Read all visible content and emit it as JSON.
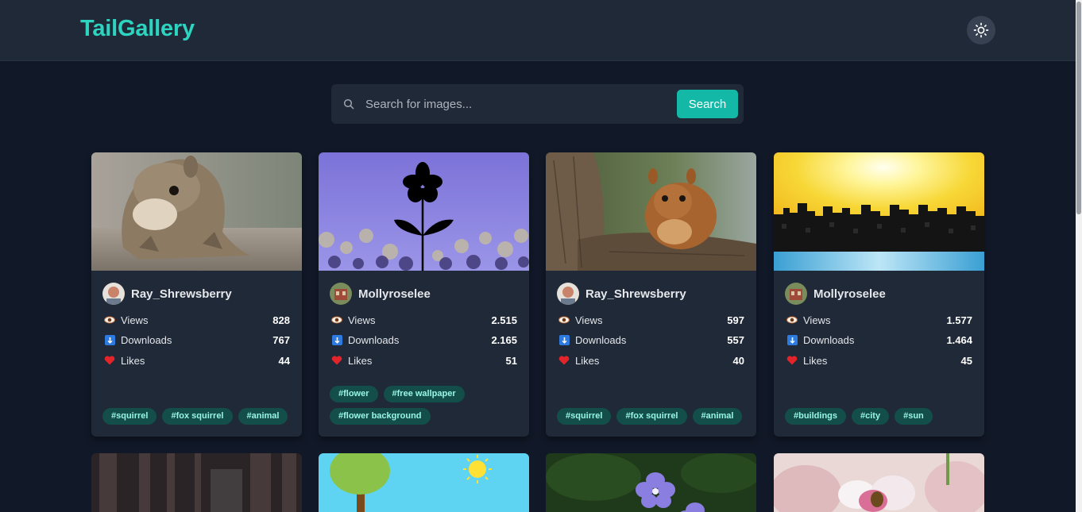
{
  "app": {
    "title": "TailGallery"
  },
  "header": {
    "theme_toggle_icon": "sun-icon"
  },
  "search": {
    "placeholder": "Search for images...",
    "value": "",
    "button_label": "Search"
  },
  "colors": {
    "accent": "#14b8a6",
    "logo": "#2dd4bf",
    "background": "#111827",
    "card": "#1f2937",
    "tag_bg": "#134e4a",
    "tag_text": "#99f6e4"
  },
  "cards": [
    {
      "image": "squirrel-on-fence",
      "author": "Ray_Shrewsberry",
      "stats": [
        {
          "icon": "eye-icon",
          "label": "Views",
          "value": "828"
        },
        {
          "icon": "download-icon",
          "label": "Downloads",
          "value": "767"
        },
        {
          "icon": "heart-icon",
          "label": "Likes",
          "value": "44"
        }
      ],
      "tags": [
        "#squirrel",
        "#fox squirrel",
        "#animal"
      ]
    },
    {
      "image": "black-flower-illustration",
      "author": "Mollyroselee",
      "stats": [
        {
          "icon": "eye-icon",
          "label": "Views",
          "value": "2.515"
        },
        {
          "icon": "download-icon",
          "label": "Downloads",
          "value": "2.165"
        },
        {
          "icon": "heart-icon",
          "label": "Likes",
          "value": "51"
        }
      ],
      "tags": [
        "#flower",
        "#free wallpaper",
        "#flower background"
      ]
    },
    {
      "image": "squirrel-on-tree",
      "author": "Ray_Shrewsberry",
      "stats": [
        {
          "icon": "eye-icon",
          "label": "Views",
          "value": "597"
        },
        {
          "icon": "download-icon",
          "label": "Downloads",
          "value": "557"
        },
        {
          "icon": "heart-icon",
          "label": "Likes",
          "value": "40"
        }
      ],
      "tags": [
        "#squirrel",
        "#fox squirrel",
        "#animal"
      ]
    },
    {
      "image": "city-skyline-sunset",
      "author": "Mollyroselee",
      "stats": [
        {
          "icon": "eye-icon",
          "label": "Views",
          "value": "1.577"
        },
        {
          "icon": "download-icon",
          "label": "Downloads",
          "value": "1.464"
        },
        {
          "icon": "heart-icon",
          "label": "Likes",
          "value": "45"
        }
      ],
      "tags": [
        "#buildings",
        "#city",
        "#sun"
      ]
    }
  ]
}
